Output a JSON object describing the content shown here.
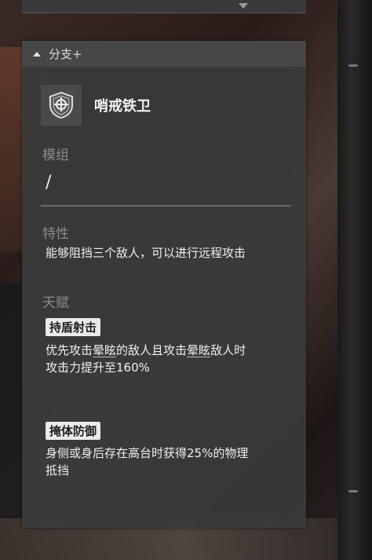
{
  "panel": {
    "header": "分支+",
    "class_name": "哨戒铁卫",
    "module": {
      "label": "模组",
      "value": "/"
    },
    "trait": {
      "label": "特性",
      "text": "能够阻挡三个敌人，可以进行远程攻击"
    },
    "talent": {
      "label": "天赋",
      "items": [
        {
          "name": "持盾射击",
          "desc_parts": [
            "优先攻击",
            "晕眩",
            "的敌人且攻击",
            "晕眩",
            "敌人时"
          ],
          "desc_line2": "攻击力提升至160%"
        },
        {
          "name": "掩体防御",
          "desc_line1": "身侧或身后存在高台时获得25%的物理",
          "desc_line2": "抵挡"
        }
      ]
    }
  },
  "icons": {
    "header_caret": "caret-up-icon",
    "class": "shield-crosshair-icon",
    "top_panel": "caret-down-icon"
  },
  "colors": {
    "panel_bg": "#3a3a3a",
    "tag_bg": "#eaeaea",
    "muted_label": "#8c8c8c"
  }
}
